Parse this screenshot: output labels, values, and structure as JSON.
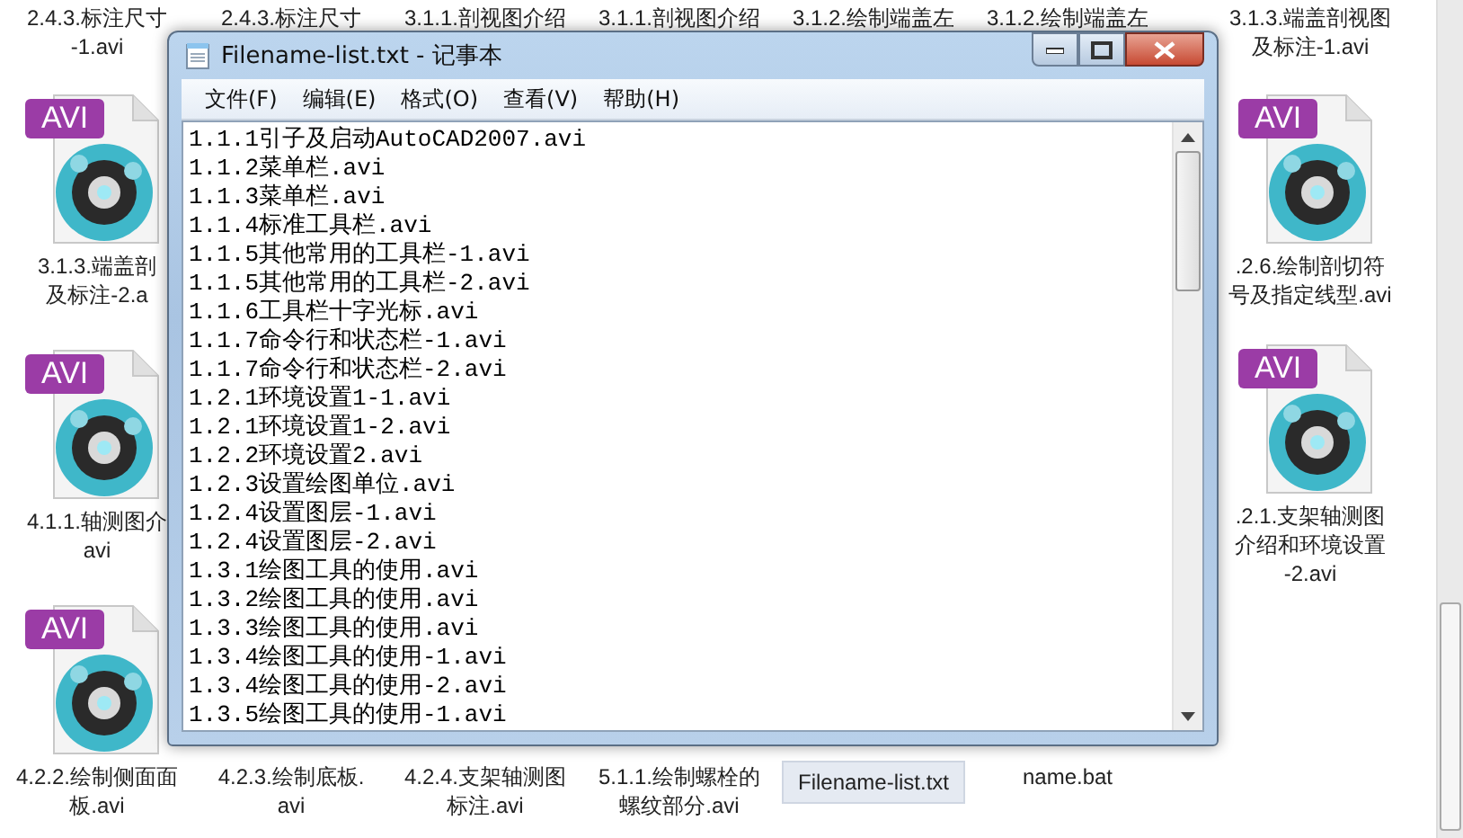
{
  "folder": {
    "rows": [
      {
        "left": [
          {
            "label": [
              "2.4.3.标注尺寸",
              "-1.avi"
            ],
            "selected": false
          },
          {
            "label": [
              "2.4.3.标注尺寸"
            ],
            "selected": false
          },
          {
            "label": [
              "3.1.1.剖视图介绍"
            ],
            "selected": false
          },
          {
            "label": [
              "3.1.1.剖视图介绍"
            ],
            "selected": false
          },
          {
            "label": [
              "3.1.2.绘制端盖左"
            ],
            "selected": false
          },
          {
            "label": [
              "3.1.2.绘制端盖左"
            ],
            "selected": false
          }
        ],
        "right": [
          {
            "label": [
              "3.1.3.端盖剖视图",
              "及标注-1.avi"
            ],
            "selected": false
          }
        ]
      },
      {
        "left": [
          {
            "icon": {
              "kind": "avi",
              "badge": "AVI"
            },
            "label": [
              "3.1.3.端盖剖",
              "及标注-2.a"
            ],
            "selected": false
          }
        ],
        "right": [
          {
            "icon": {
              "kind": "avi",
              "badge": "AVI"
            },
            "label": [
              ".2.6.绘制剖切符",
              "号及指定线型.avi"
            ],
            "selected": false
          }
        ]
      },
      {
        "left": [
          {
            "icon": {
              "kind": "avi",
              "badge": "AVI"
            },
            "label": [
              "4.1.1.轴测图介",
              "avi"
            ],
            "selected": false
          }
        ],
        "right": [
          {
            "icon": {
              "kind": "avi",
              "badge": "AVI"
            },
            "label": [
              ".2.1.支架轴测图",
              "介绍和环境设置",
              "-2.avi"
            ],
            "selected": false
          }
        ]
      },
      {
        "left": [
          {
            "icon": {
              "kind": "avi",
              "badge": "AVI"
            },
            "label": [
              "4.2.2.绘制侧面面",
              "板.avi"
            ],
            "selected": false
          },
          {
            "label": [
              "4.2.3.绘制底板.",
              "avi"
            ],
            "selected": false
          },
          {
            "label": [
              "4.2.4.支架轴测图",
              "标注.avi"
            ],
            "selected": false
          },
          {
            "label": [
              "5.1.1.绘制螺栓的",
              "螺纹部分.avi"
            ],
            "selected": false
          },
          {
            "label": [
              "Filename-list.txt"
            ],
            "selected": true
          },
          {
            "label": [
              "name.bat"
            ],
            "selected": false
          }
        ]
      }
    ]
  },
  "notepad": {
    "title": "Filename-list.txt - 记事本",
    "menu": [
      "文件(F)",
      "编辑(E)",
      "格式(O)",
      "查看(V)",
      "帮助(H)"
    ],
    "lines": [
      "1.1.1引子及启动AutoCAD2007.avi",
      "1.1.2菜单栏.avi",
      "1.1.3菜单栏.avi",
      "1.1.4标准工具栏.avi",
      "1.1.5其他常用的工具栏-1.avi",
      "1.1.5其他常用的工具栏-2.avi",
      "1.1.6工具栏十字光标.avi",
      "1.1.7命令行和状态栏-1.avi",
      "1.1.7命令行和状态栏-2.avi",
      "1.2.1环境设置1-1.avi",
      "1.2.1环境设置1-2.avi",
      "1.2.2环境设置2.avi",
      "1.2.3设置绘图单位.avi",
      "1.2.4设置图层-1.avi",
      "1.2.4设置图层-2.avi",
      "1.3.1绘图工具的使用.avi",
      "1.3.2绘图工具的使用.avi",
      "1.3.3绘图工具的使用.avi",
      "1.3.4绘图工具的使用-1.avi",
      "1.3.4绘图工具的使用-2.avi",
      "1.3.5绘图工具的使用-1.avi"
    ]
  }
}
